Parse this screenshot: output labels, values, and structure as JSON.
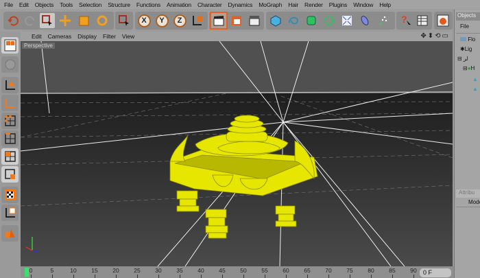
{
  "menu": [
    "File",
    "Edit",
    "Objects",
    "Tools",
    "Selection",
    "Structure",
    "Functions",
    "Animation",
    "Character",
    "Dynamics",
    "MoGraph",
    "Hair",
    "Render",
    "Plugins",
    "Window",
    "Help"
  ],
  "toolbar": {
    "x_label": "X",
    "y_label": "Y",
    "z_label": "Z"
  },
  "viewport_menu": [
    "Edit",
    "Cameras",
    "Display",
    "Filter",
    "View"
  ],
  "viewport_icons": "✥⬍⟲▭",
  "viewport_label": "Perspective",
  "objects_panel": {
    "tab": "Objects",
    "file": "File",
    "items": [
      "Flo",
      "Lig",
      "لر",
      "H"
    ]
  },
  "attributes_panel": {
    "tab": "Attribu",
    "mode": "Mode"
  },
  "timeline": {
    "ticks": [
      "0",
      "5",
      "10",
      "15",
      "20",
      "25",
      "30",
      "35",
      "40",
      "45",
      "50",
      "55",
      "60",
      "65",
      "70",
      "75",
      "80",
      "85",
      "90"
    ],
    "current_frame": "0 F"
  },
  "colors": {
    "accent": "#e0622a",
    "model": "#e6e600",
    "viewport": "#3a3a3a"
  }
}
